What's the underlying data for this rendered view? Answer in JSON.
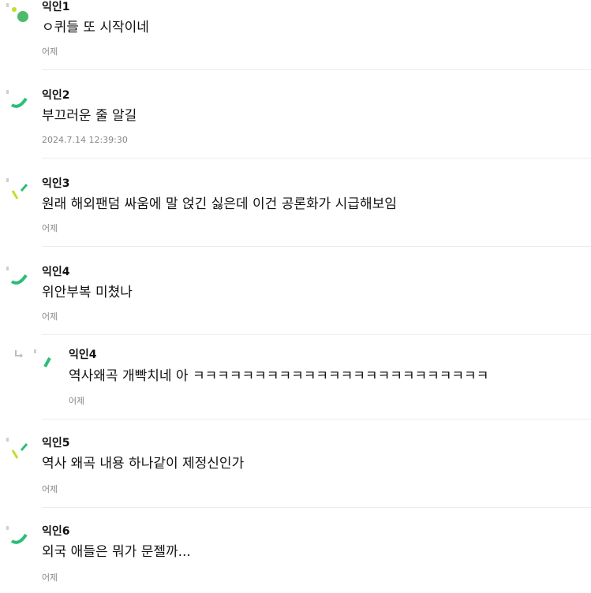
{
  "comments": [
    {
      "author": "익인1",
      "text": "ㅇ퀴들 또 시작이네",
      "time": "어제",
      "avatar_icon": "dots-avatar-icon"
    },
    {
      "author": "익인2",
      "text": "부끄러운 줄 알길",
      "time": "2024.7.14 12:39:30",
      "avatar_icon": "arc-avatar-icon"
    },
    {
      "author": "익인3",
      "text": "원래 해외팬덤 싸움에 말 얹긴 싫은데 이건 공론화가 시급해보임",
      "time": "어제",
      "avatar_icon": "slash-avatar-icon"
    },
    {
      "author": "익인4",
      "text": "위안부복 미쳤나",
      "time": "어제",
      "avatar_icon": "arc-avatar-icon"
    },
    {
      "author": "익인4",
      "text": "역사왜곡 개빡치네 아 ㅋㅋㅋㅋㅋㅋㅋㅋㅋㅋㅋㅋㅋㅋㅋㅋㅋㅋㅋㅋㅋㅋㅋㅋ",
      "time": "어제",
      "avatar_icon": "bar-avatar-icon",
      "is_reply": true
    },
    {
      "author": "익인5",
      "text": "역사 왜곡 내용 하나같이 제정신인가",
      "time": "어제",
      "avatar_icon": "slash-avatar-icon"
    },
    {
      "author": "익인6",
      "text": "외국 애들은 뭐가 문젤까...",
      "time": "어제",
      "avatar_icon": "arc-avatar-icon"
    }
  ],
  "colors": {
    "green": "#2dbd79",
    "lime": "#c5dd2a",
    "gray": "#cfcfcf"
  }
}
